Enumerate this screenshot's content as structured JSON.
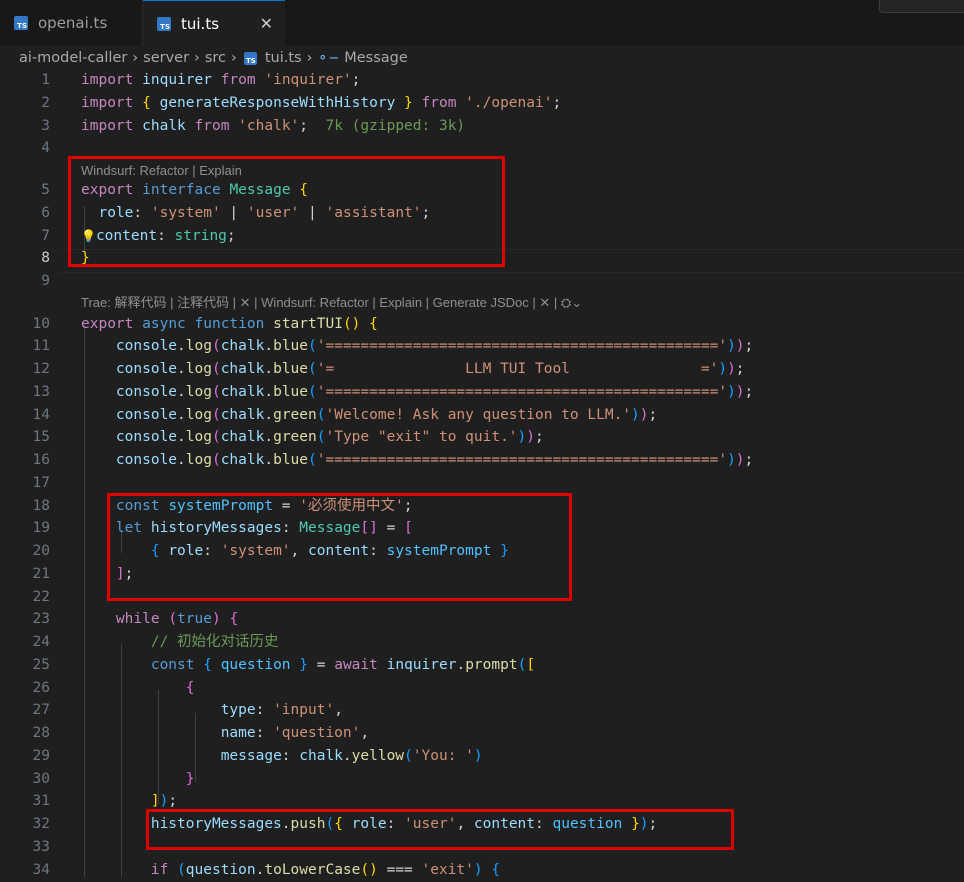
{
  "tabs": [
    {
      "label": "openai.ts",
      "icon": "ts-file-icon",
      "active": false
    },
    {
      "label": "tui.ts",
      "icon": "ts-file-icon",
      "active": true,
      "close": "✕"
    }
  ],
  "breadcrumb": {
    "items": [
      "ai-model-caller",
      "server",
      "src",
      "tui.ts",
      "Message"
    ],
    "separator": "›"
  },
  "code_lens": {
    "line5": "Windsurf: Refactor | Explain",
    "line10": "Trae: 解释代码 | 注释代码 | ✕ | Windsurf: Refactor | Explain | Generate JSDoc | ✕ | ⛭⌄"
  },
  "lines": [
    {
      "n": "1",
      "t": [
        [
          "kw",
          "import"
        ],
        [
          "pun",
          " "
        ],
        [
          "var",
          "inquirer"
        ],
        [
          "pun",
          " "
        ],
        [
          "kw",
          "from"
        ],
        [
          "pun",
          " "
        ],
        [
          "str",
          "'inquirer'"
        ],
        [
          "pun",
          ";"
        ]
      ]
    },
    {
      "n": "2",
      "t": [
        [
          "kw",
          "import"
        ],
        [
          "pun",
          " "
        ],
        [
          "b1",
          "{"
        ],
        [
          "pun",
          " "
        ],
        [
          "var",
          "generateResponseWithHistory"
        ],
        [
          "pun",
          " "
        ],
        [
          "b1",
          "}"
        ],
        [
          "pun",
          " "
        ],
        [
          "kw",
          "from"
        ],
        [
          "pun",
          " "
        ],
        [
          "str",
          "'./openai'"
        ],
        [
          "pun",
          ";"
        ]
      ]
    },
    {
      "n": "3",
      "t": [
        [
          "kw",
          "import"
        ],
        [
          "pun",
          " "
        ],
        [
          "var",
          "chalk"
        ],
        [
          "pun",
          " "
        ],
        [
          "kw",
          "from"
        ],
        [
          "pun",
          " "
        ],
        [
          "str",
          "'chalk'"
        ],
        [
          "pun",
          ";  "
        ],
        [
          "size",
          "7k (gzipped: 3k)"
        ]
      ]
    },
    {
      "n": "4",
      "t": []
    },
    {
      "n": "5",
      "t": [
        [
          "kw",
          "export"
        ],
        [
          "pun",
          " "
        ],
        [
          "kb",
          "interface"
        ],
        [
          "pun",
          " "
        ],
        [
          "typ",
          "Message"
        ],
        [
          "pun",
          " "
        ],
        [
          "b1",
          "{"
        ]
      ]
    },
    {
      "n": "6",
      "t": [
        [
          "pun",
          "  "
        ],
        [
          "var",
          "role"
        ],
        [
          "pun",
          ": "
        ],
        [
          "str",
          "'system'"
        ],
        [
          "pun",
          " | "
        ],
        [
          "str",
          "'user'"
        ],
        [
          "pun",
          " | "
        ],
        [
          "str",
          "'assistant'"
        ],
        [
          "pun",
          ";"
        ]
      ]
    },
    {
      "n": "7",
      "t": [
        [
          "bulb",
          "💡"
        ],
        [
          "var",
          "content"
        ],
        [
          "pun",
          ": "
        ],
        [
          "typ",
          "string"
        ],
        [
          "pun",
          ";"
        ]
      ]
    },
    {
      "n": "8",
      "t": [
        [
          "b1",
          "}"
        ]
      ]
    },
    {
      "n": "9",
      "t": []
    },
    {
      "n": "10",
      "t": [
        [
          "kw",
          "export"
        ],
        [
          "pun",
          " "
        ],
        [
          "kb",
          "async"
        ],
        [
          "pun",
          " "
        ],
        [
          "kb",
          "function"
        ],
        [
          "pun",
          " "
        ],
        [
          "fn",
          "startTUI"
        ],
        [
          "b1",
          "()"
        ],
        [
          "pun",
          " "
        ],
        [
          "b1",
          "{"
        ]
      ]
    },
    {
      "n": "11",
      "t": [
        [
          "pun",
          "    "
        ],
        [
          "var",
          "console"
        ],
        [
          "pun",
          "."
        ],
        [
          "fn",
          "log"
        ],
        [
          "b2",
          "("
        ],
        [
          "var",
          "chalk"
        ],
        [
          "pun",
          "."
        ],
        [
          "fn",
          "blue"
        ],
        [
          "b3",
          "("
        ],
        [
          "str",
          "'============================================='"
        ],
        [
          "b3",
          ")"
        ],
        [
          "b2",
          ")"
        ],
        [
          "pun",
          ";"
        ]
      ]
    },
    {
      "n": "12",
      "t": [
        [
          "pun",
          "    "
        ],
        [
          "var",
          "console"
        ],
        [
          "pun",
          "."
        ],
        [
          "fn",
          "log"
        ],
        [
          "b2",
          "("
        ],
        [
          "var",
          "chalk"
        ],
        [
          "pun",
          "."
        ],
        [
          "fn",
          "blue"
        ],
        [
          "b3",
          "("
        ],
        [
          "str",
          "'=               LLM TUI Tool               ='"
        ],
        [
          "b3",
          ")"
        ],
        [
          "b2",
          ")"
        ],
        [
          "pun",
          ";"
        ]
      ]
    },
    {
      "n": "13",
      "t": [
        [
          "pun",
          "    "
        ],
        [
          "var",
          "console"
        ],
        [
          "pun",
          "."
        ],
        [
          "fn",
          "log"
        ],
        [
          "b2",
          "("
        ],
        [
          "var",
          "chalk"
        ],
        [
          "pun",
          "."
        ],
        [
          "fn",
          "blue"
        ],
        [
          "b3",
          "("
        ],
        [
          "str",
          "'============================================='"
        ],
        [
          "b3",
          ")"
        ],
        [
          "b2",
          ")"
        ],
        [
          "pun",
          ";"
        ]
      ]
    },
    {
      "n": "14",
      "t": [
        [
          "pun",
          "    "
        ],
        [
          "var",
          "console"
        ],
        [
          "pun",
          "."
        ],
        [
          "fn",
          "log"
        ],
        [
          "b2",
          "("
        ],
        [
          "var",
          "chalk"
        ],
        [
          "pun",
          "."
        ],
        [
          "fn",
          "green"
        ],
        [
          "b3",
          "("
        ],
        [
          "str",
          "'Welcome! Ask any question to LLM.'"
        ],
        [
          "b3",
          ")"
        ],
        [
          "b2",
          ")"
        ],
        [
          "pun",
          ";"
        ]
      ]
    },
    {
      "n": "15",
      "t": [
        [
          "pun",
          "    "
        ],
        [
          "var",
          "console"
        ],
        [
          "pun",
          "."
        ],
        [
          "fn",
          "log"
        ],
        [
          "b2",
          "("
        ],
        [
          "var",
          "chalk"
        ],
        [
          "pun",
          "."
        ],
        [
          "fn",
          "green"
        ],
        [
          "b3",
          "("
        ],
        [
          "str",
          "'Type \"exit\" to quit.'"
        ],
        [
          "b3",
          ")"
        ],
        [
          "b2",
          ")"
        ],
        [
          "pun",
          ";"
        ]
      ]
    },
    {
      "n": "16",
      "t": [
        [
          "pun",
          "    "
        ],
        [
          "var",
          "console"
        ],
        [
          "pun",
          "."
        ],
        [
          "fn",
          "log"
        ],
        [
          "b2",
          "("
        ],
        [
          "var",
          "chalk"
        ],
        [
          "pun",
          "."
        ],
        [
          "fn",
          "blue"
        ],
        [
          "b3",
          "("
        ],
        [
          "str",
          "'============================================='"
        ],
        [
          "b3",
          ")"
        ],
        [
          "b2",
          ")"
        ],
        [
          "pun",
          ";"
        ]
      ]
    },
    {
      "n": "17",
      "t": []
    },
    {
      "n": "18",
      "t": [
        [
          "pun",
          "    "
        ],
        [
          "kb",
          "const"
        ],
        [
          "pun",
          " "
        ],
        [
          "cst",
          "systemPrompt"
        ],
        [
          "pun",
          " = "
        ],
        [
          "str",
          "'必须使用中文'"
        ],
        [
          "pun",
          ";"
        ]
      ]
    },
    {
      "n": "19",
      "t": [
        [
          "pun",
          "    "
        ],
        [
          "kb",
          "let"
        ],
        [
          "pun",
          " "
        ],
        [
          "var",
          "historyMessages"
        ],
        [
          "pun",
          ": "
        ],
        [
          "typ",
          "Message"
        ],
        [
          "b2",
          "[]"
        ],
        [
          "pun",
          " = "
        ],
        [
          "b2",
          "["
        ]
      ]
    },
    {
      "n": "20",
      "t": [
        [
          "pun",
          "        "
        ],
        [
          "b3",
          "{"
        ],
        [
          "pun",
          " "
        ],
        [
          "var",
          "role"
        ],
        [
          "pun",
          ": "
        ],
        [
          "str",
          "'system'"
        ],
        [
          "pun",
          ", "
        ],
        [
          "var",
          "content"
        ],
        [
          "pun",
          ": "
        ],
        [
          "cst",
          "systemPrompt"
        ],
        [
          "pun",
          " "
        ],
        [
          "b3",
          "}"
        ]
      ]
    },
    {
      "n": "21",
      "t": [
        [
          "pun",
          "    "
        ],
        [
          "b2",
          "]"
        ],
        [
          "pun",
          ";"
        ]
      ]
    },
    {
      "n": "22",
      "t": []
    },
    {
      "n": "23",
      "t": [
        [
          "pun",
          "    "
        ],
        [
          "kw",
          "while"
        ],
        [
          "pun",
          " "
        ],
        [
          "b2",
          "("
        ],
        [
          "kb",
          "true"
        ],
        [
          "b2",
          ")"
        ],
        [
          "pun",
          " "
        ],
        [
          "b2",
          "{"
        ]
      ]
    },
    {
      "n": "24",
      "t": [
        [
          "pun",
          "        "
        ],
        [
          "cmt",
          "// 初始化对话历史"
        ]
      ]
    },
    {
      "n": "25",
      "t": [
        [
          "pun",
          "        "
        ],
        [
          "kb",
          "const"
        ],
        [
          "pun",
          " "
        ],
        [
          "b3",
          "{"
        ],
        [
          "pun",
          " "
        ],
        [
          "cst",
          "question"
        ],
        [
          "pun",
          " "
        ],
        [
          "b3",
          "}"
        ],
        [
          "pun",
          " = "
        ],
        [
          "kw",
          "await"
        ],
        [
          "pun",
          " "
        ],
        [
          "var",
          "inquirer"
        ],
        [
          "pun",
          "."
        ],
        [
          "fn",
          "prompt"
        ],
        [
          "b3",
          "("
        ],
        [
          "b1",
          "["
        ]
      ]
    },
    {
      "n": "26",
      "t": [
        [
          "pun",
          "            "
        ],
        [
          "b2",
          "{"
        ]
      ]
    },
    {
      "n": "27",
      "t": [
        [
          "pun",
          "                "
        ],
        [
          "var",
          "type"
        ],
        [
          "pun",
          ": "
        ],
        [
          "str",
          "'input'"
        ],
        [
          "pun",
          ","
        ]
      ]
    },
    {
      "n": "28",
      "t": [
        [
          "pun",
          "                "
        ],
        [
          "var",
          "name"
        ],
        [
          "pun",
          ": "
        ],
        [
          "str",
          "'question'"
        ],
        [
          "pun",
          ","
        ]
      ]
    },
    {
      "n": "29",
      "t": [
        [
          "pun",
          "                "
        ],
        [
          "var",
          "message"
        ],
        [
          "pun",
          ": "
        ],
        [
          "var",
          "chalk"
        ],
        [
          "pun",
          "."
        ],
        [
          "fn",
          "yellow"
        ],
        [
          "b3",
          "("
        ],
        [
          "str",
          "'You: '"
        ],
        [
          "b3",
          ")"
        ]
      ]
    },
    {
      "n": "30",
      "t": [
        [
          "pun",
          "            "
        ],
        [
          "b2",
          "}"
        ]
      ]
    },
    {
      "n": "31",
      "t": [
        [
          "pun",
          "        "
        ],
        [
          "b1",
          "]"
        ],
        [
          "b3",
          ")"
        ],
        [
          "pun",
          ";"
        ]
      ]
    },
    {
      "n": "32",
      "t": [
        [
          "pun",
          "        "
        ],
        [
          "var",
          "historyMessages"
        ],
        [
          "pun",
          "."
        ],
        [
          "fn",
          "push"
        ],
        [
          "b3",
          "("
        ],
        [
          "b1",
          "{"
        ],
        [
          "pun",
          " "
        ],
        [
          "var",
          "role"
        ],
        [
          "pun",
          ": "
        ],
        [
          "str",
          "'user'"
        ],
        [
          "pun",
          ", "
        ],
        [
          "var",
          "content"
        ],
        [
          "pun",
          ": "
        ],
        [
          "cst",
          "question"
        ],
        [
          "pun",
          " "
        ],
        [
          "b1",
          "}"
        ],
        [
          "b3",
          ")"
        ],
        [
          "pun",
          ";"
        ]
      ]
    },
    {
      "n": "33",
      "t": []
    },
    {
      "n": "34",
      "t": [
        [
          "pun",
          "        "
        ],
        [
          "kw",
          "if"
        ],
        [
          "pun",
          " "
        ],
        [
          "b3",
          "("
        ],
        [
          "var",
          "question"
        ],
        [
          "pun",
          "."
        ],
        [
          "fn",
          "toLowerCase"
        ],
        [
          "b1",
          "()"
        ],
        [
          "pun",
          " === "
        ],
        [
          "str",
          "'exit'"
        ],
        [
          "b3",
          ")"
        ],
        [
          "pun",
          " "
        ],
        [
          "b3",
          "{"
        ]
      ]
    }
  ]
}
